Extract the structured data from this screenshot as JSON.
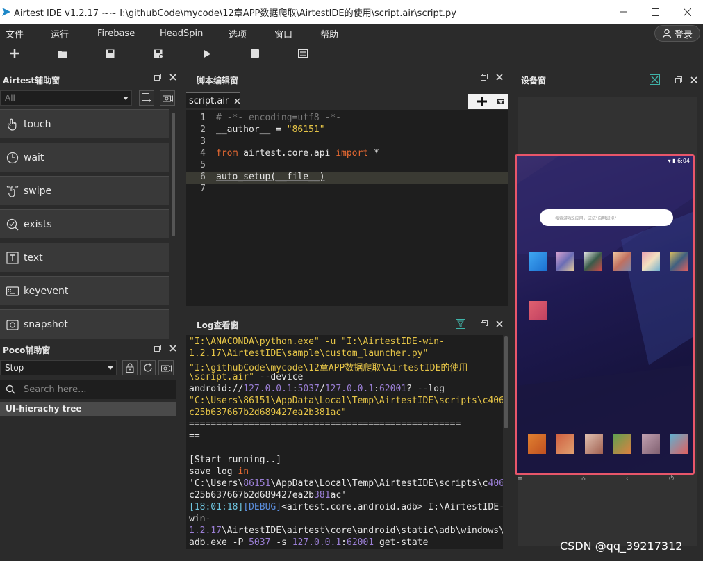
{
  "window": {
    "title": "Airtest IDE v1.2.17 ~~ I:\\githubCode\\mycode\\12章APP数据爬取\\AirtestIDE的使用\\script.air\\script.py"
  },
  "menu": [
    "文件",
    "运行",
    "Firebase",
    "HeadSpin",
    "选项",
    "窗口",
    "帮助"
  ],
  "login_label": "登录",
  "toolbar_icons": [
    "new-icon",
    "open-folder-icon",
    "save-icon",
    "save-as-icon",
    "run-icon",
    "stop-icon",
    "log-view-icon"
  ],
  "airtest_panel": {
    "title": "Airtest辅助窗",
    "combo_value": "All",
    "commands": [
      {
        "label": "touch",
        "icon": "touch-icon"
      },
      {
        "label": "wait",
        "icon": "clock-icon"
      },
      {
        "label": "swipe",
        "icon": "swipe-icon"
      },
      {
        "label": "exists",
        "icon": "search-check-icon"
      },
      {
        "label": "text",
        "icon": "text-icon"
      },
      {
        "label": "keyevent",
        "icon": "keyboard-icon"
      },
      {
        "label": "snapshot",
        "icon": "camera-icon"
      }
    ]
  },
  "poco_panel": {
    "title": "Poco辅助窗",
    "combo_value": "Stop",
    "search_placeholder": "Search here...",
    "tree_header": "UI-hierachy tree"
  },
  "editor_panel": {
    "title": "脚本编辑窗",
    "tab_label": "script.air",
    "lines": [
      {
        "n": "1",
        "text": "# -*- encoding=utf8 -*-"
      },
      {
        "n": "2",
        "text": "__author__ = \"86151\""
      },
      {
        "n": "3",
        "text": ""
      },
      {
        "n": "4",
        "text": "from airtest.core.api import *"
      },
      {
        "n": "5",
        "text": ""
      },
      {
        "n": "6",
        "text": "auto_setup(__file__)"
      },
      {
        "n": "7",
        "text": ""
      }
    ]
  },
  "log_panel": {
    "title": "Log查看窗",
    "lines": [
      "\"I:\\ANACONDA\\python.exe\" -u \"I:\\AirtestIDE-win-",
      "1.2.17\\AirtestIDE\\sample\\custom_launcher.py\"",
      "\"I:\\githubCode\\mycode\\12章APP数据爬取\\AirtestIDE的使用",
      "\\script.air\" --device",
      "android://127.0.0.1:5037/127.0.0.1:62001? --log",
      "\"C:\\Users\\86151\\AppData\\Local\\Temp\\AirtestIDE\\scripts\\c406",
      "c25b637667b2d689427ea2b381ac\"",
      "==================================================",
      "==",
      "",
      "[Start running..]",
      "save log in",
      "'C:\\Users\\86151\\AppData\\Local\\Temp\\AirtestIDE\\scripts\\c406",
      "c25b637667b2d689427ea2b381ac'",
      "[18:01:18][DEBUG]<airtest.core.android.adb> I:\\AirtestIDE-",
      "win-",
      "1.2.17\\AirtestIDE\\airtest\\core\\android\\static\\adb\\windows\\",
      "adb.exe -P 5037 -s 127.0.0.1:62001 get-state"
    ]
  },
  "device_panel": {
    "title": "设备窗",
    "status_time": "6:04",
    "search_placeholder": "搜索游戏&应用，试试\"启明幻境\""
  },
  "watermark": "CSDN @qq_39217312"
}
